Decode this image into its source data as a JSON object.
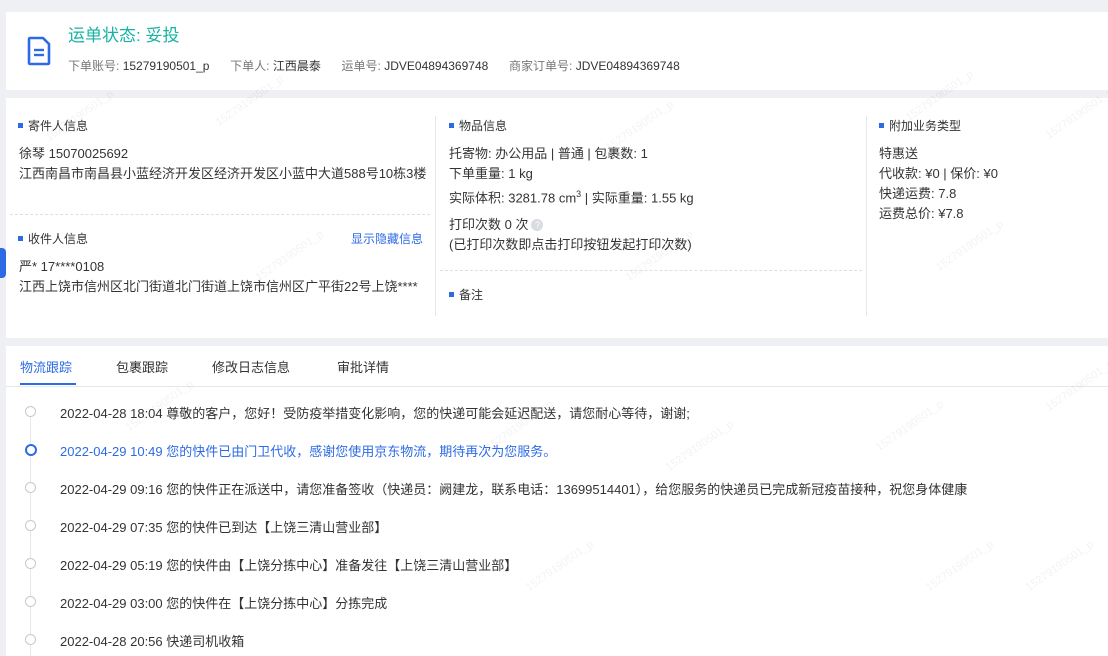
{
  "header": {
    "status_label": "运单状态: 妥投",
    "order_account_label": "下单账号:",
    "order_account": "15279190501_p",
    "orderer_label": "下单人:",
    "orderer": "江西晨泰",
    "waybill_label": "运单号:",
    "waybill": "JDVE04894369748",
    "merchant_order_label": "商家订单号:",
    "merchant_order": "JDVE04894369748"
  },
  "sender": {
    "title": "寄件人信息",
    "name_phone": "徐琴   15070025692",
    "address": "江西南昌市南昌县小蓝经济开发区经济开发区小蓝中大道588号10栋3楼"
  },
  "receiver": {
    "title": "收件人信息",
    "show_hidden": "显示隐藏信息",
    "name_phone": "严*   17****0108",
    "address": "江西上饶市信州区北门街道北门街道上饶市信州区广平街22号上饶****"
  },
  "goods": {
    "title": "物品信息",
    "line1": "托寄物:  办公用品 | 普通  |  包裹数:  1",
    "line2": "下单重量:   1 kg",
    "volume_label": "实际体积:   3281.78 cm",
    "volume_sup": "3",
    "volume_tail": "  |  实际重量:   1.55 kg",
    "print_count": "打印次数    0 次",
    "help_glyph": "?",
    "print_note": "(已打印次数即点击打印按钮发起打印次数)",
    "remark_title": "备注"
  },
  "addon": {
    "title": "附加业务类型",
    "service": "特惠送",
    "cod": "代收款:   ¥0  |  保价:   ¥0",
    "freight": "快递运费:    7.8",
    "total": "运费总价:   ¥7.8"
  },
  "tabs": [
    "物流跟踪",
    "包裹跟踪",
    "修改日志信息",
    "审批详情"
  ],
  "timeline": [
    {
      "text": "2022-04-28 18:04 尊敬的客户，您好！受防疫举措变化影响，您的快递可能会延迟配送，请您耐心等待，谢谢;",
      "current": false
    },
    {
      "text": "2022-04-29 10:49 您的快件已由门卫代收，感谢您使用京东物流，期待再次为您服务。",
      "current": true
    },
    {
      "text": "2022-04-29 09:16 您的快件正在派送中，请您准备签收（快递员：阙建龙，联系电话：13699514401），给您服务的快递员已完成新冠疫苗接种，祝您身体健康",
      "current": false
    },
    {
      "text": "2022-04-29 07:35 您的快件已到达【上饶三清山营业部】",
      "current": false
    },
    {
      "text": "2022-04-29 05:19 您的快件由【上饶分拣中心】准备发往【上饶三清山营业部】",
      "current": false
    },
    {
      "text": "2022-04-29 03:00 您的快件在【上饶分拣中心】分拣完成",
      "current": false
    },
    {
      "text": "2022-04-28 20:56 快递司机收箱",
      "current": false
    }
  ],
  "watermark": "15279190501_p",
  "colors": {
    "accent": "#2d6be4",
    "status": "#17b3a3"
  }
}
